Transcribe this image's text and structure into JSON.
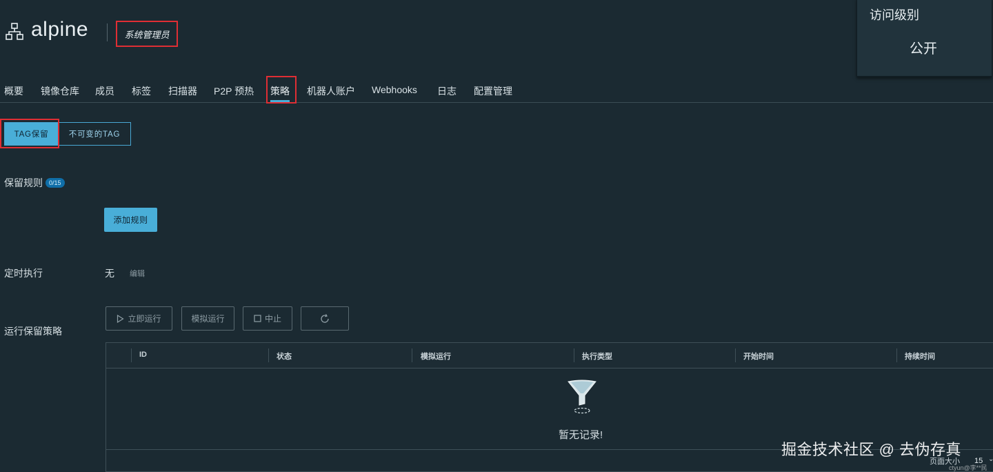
{
  "header": {
    "project_name": "alpine",
    "role": "系统管理员"
  },
  "access_panel": {
    "label": "访问级别",
    "value": "公开"
  },
  "nav": {
    "tabs": [
      {
        "label": "概要"
      },
      {
        "label": "镜像仓库"
      },
      {
        "label": "成员"
      },
      {
        "label": "标签"
      },
      {
        "label": "扫描器"
      },
      {
        "label": "P2P 预热"
      },
      {
        "label": "策略"
      },
      {
        "label": "机器人账户"
      },
      {
        "label": "Webhooks"
      },
      {
        "label": "日志"
      },
      {
        "label": "配置管理"
      }
    ],
    "active_tab": "策略"
  },
  "subtabs": {
    "active": "TAG保留",
    "inactive": "不可变的TAG"
  },
  "retention": {
    "label": "保留规则",
    "count_badge": "0/15",
    "add_rule_label": "添加规则"
  },
  "schedule": {
    "label": "定时执行",
    "value": "无",
    "edit_label": "编辑"
  },
  "run": {
    "label": "运行保留策略",
    "run_now_label": "立即运行",
    "dry_run_label": "模拟运行",
    "abort_label": "中止"
  },
  "grid": {
    "columns": [
      "ID",
      "状态",
      "模拟运行",
      "执行类型",
      "开始时间",
      "持续时间"
    ],
    "empty_text": "暂无记录!"
  },
  "pagination": {
    "page_size_label": "页面大小",
    "page_size_value": "15"
  },
  "watermark": {
    "text": "掘金技术社区 @ 去伪存真",
    "small_text": "ctyun@李**民"
  },
  "colors": {
    "background": "#1b2a32",
    "accent": "#49aed8",
    "highlight_border": "#e02e34"
  }
}
